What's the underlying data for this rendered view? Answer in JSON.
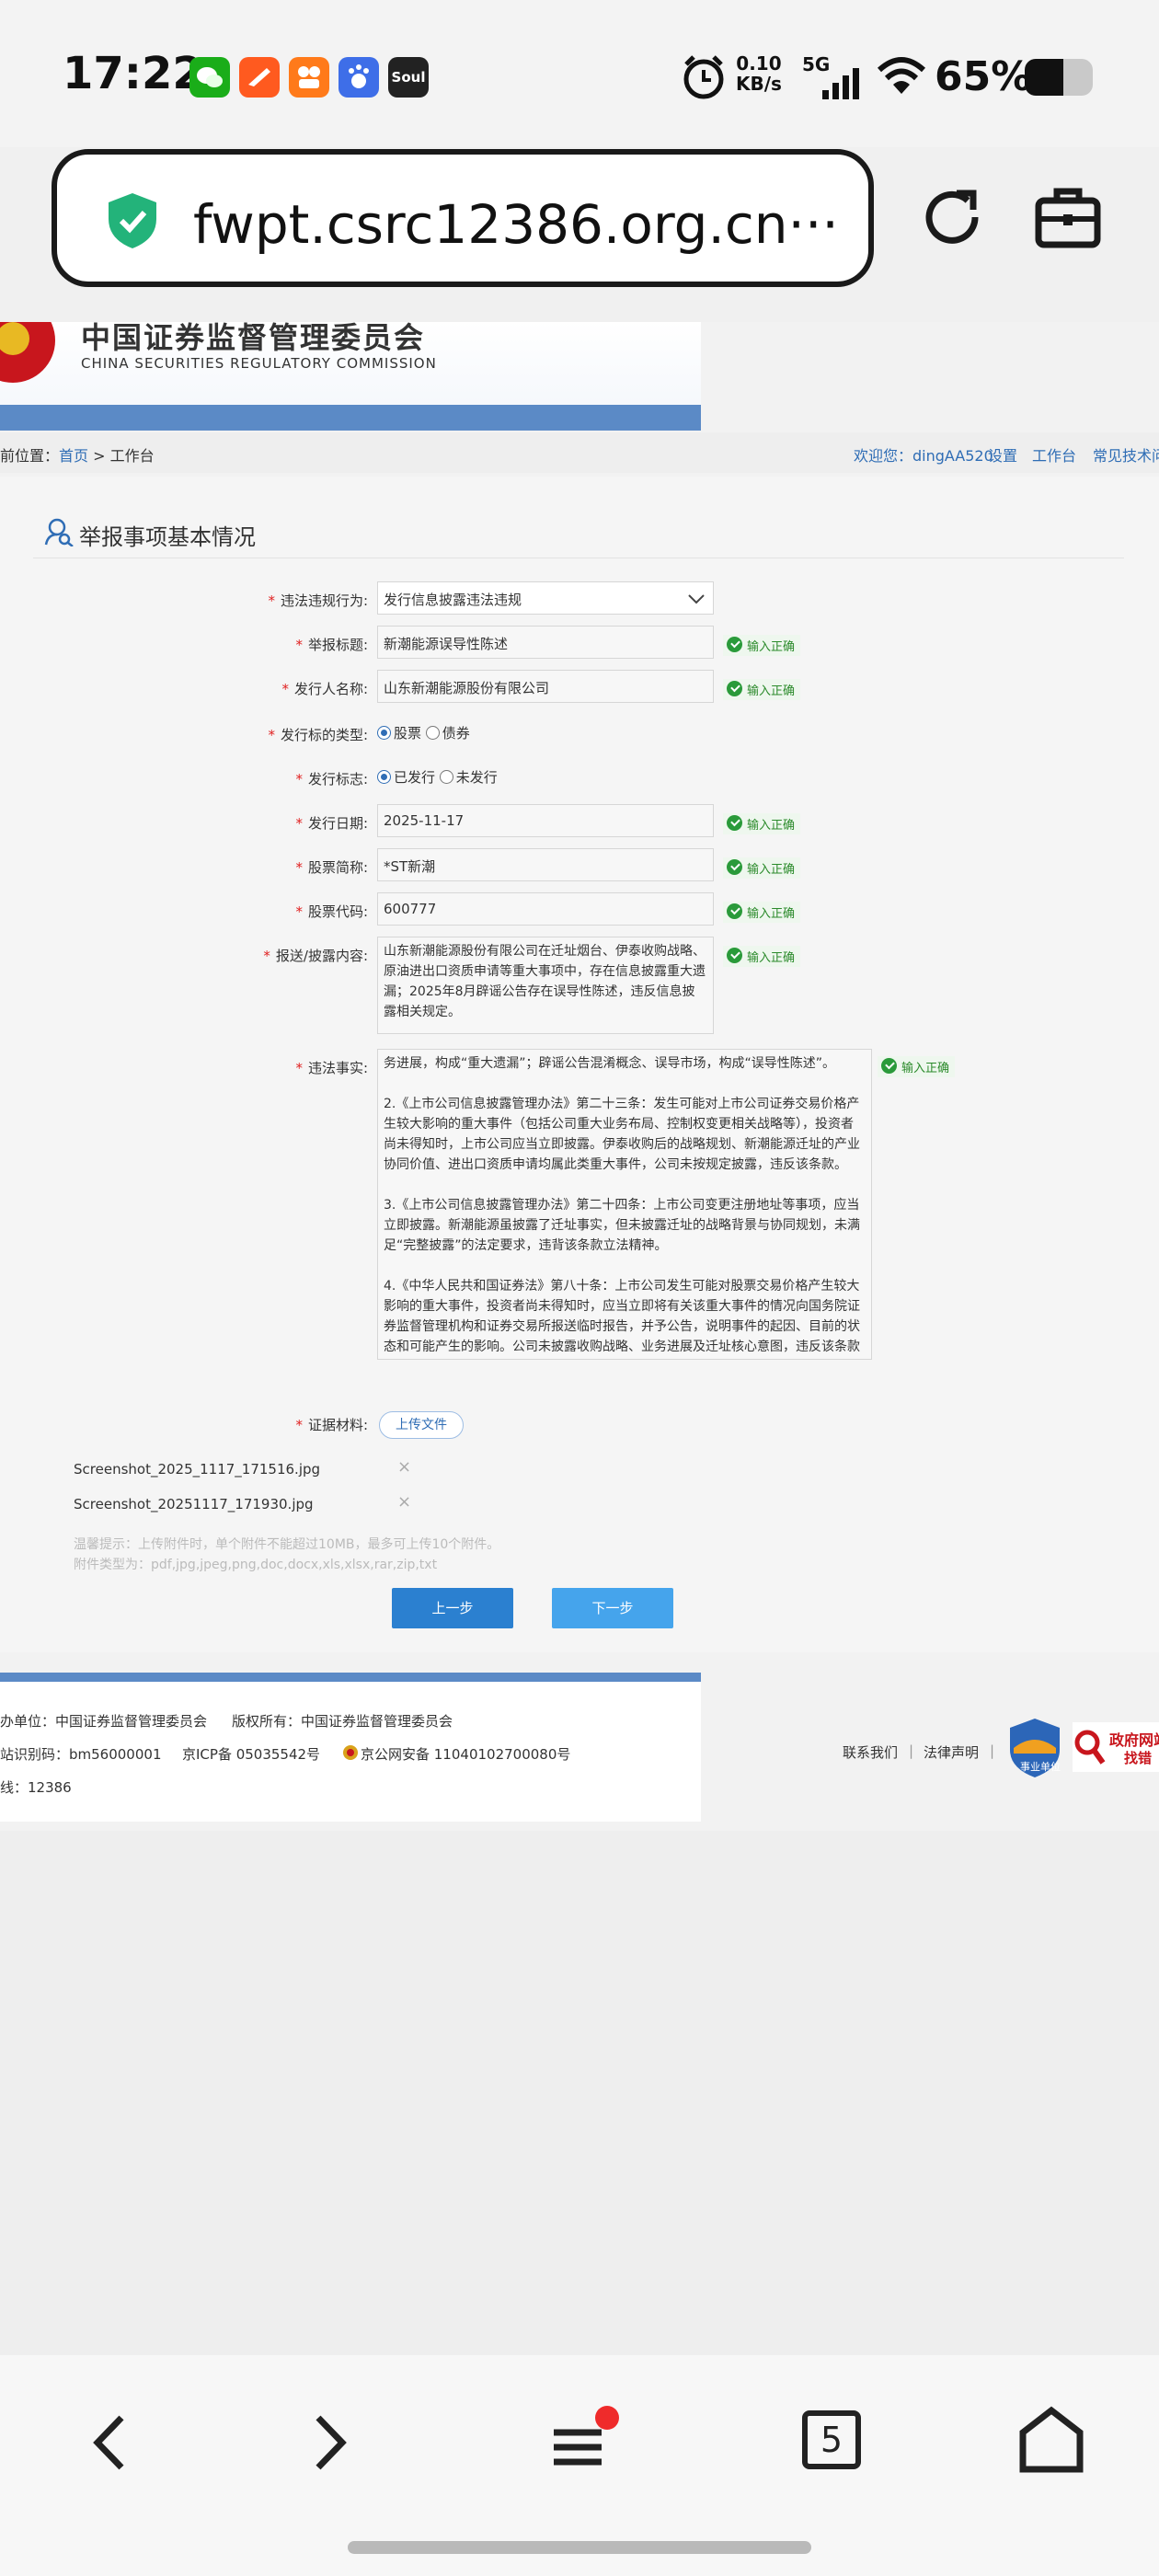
{
  "status_bar": {
    "time": "17:22",
    "net_speed_value": "0.10",
    "net_speed_unit": "KB/s",
    "network": "5G",
    "battery": "65%",
    "apps": [
      {
        "name": "wechat-icon",
        "color": "#1aad19"
      },
      {
        "name": "feishu-icon",
        "color": "#ff5a1f"
      },
      {
        "name": "kuaishou-icon",
        "color": "#ff7a1a"
      },
      {
        "name": "baidu-icon",
        "color": "#3e6ee8"
      },
      {
        "name": "soul-icon",
        "color": "#222222",
        "label": "Soul"
      }
    ]
  },
  "browser": {
    "url": "fwpt.csrc12386.org.cn···"
  },
  "site": {
    "banner_cn": "中国证券监督管理委员会",
    "banner_en": "CHINA SECURITIES REGULATORY COMMISSION",
    "breadcrumb_prefix": "前位置：",
    "breadcrumb_home": "首页",
    "breadcrumb_sep": " > ",
    "breadcrumb_current": "工作台",
    "welcome": "欢迎您：dingAA520",
    "links": [
      "设置",
      "工作台",
      "常见技术问"
    ]
  },
  "form": {
    "section_title": "举报事项基本情况",
    "ok_text": "输入正确",
    "fields": {
      "behavior": {
        "label": "违法违规行为:",
        "value": "发行信息披露违法违规"
      },
      "title": {
        "label": "举报标题:",
        "value": "新潮能源误导性陈述"
      },
      "issuer": {
        "label": "发行人名称:",
        "value": "山东新潮能源股份有限公司"
      },
      "type": {
        "label": "发行标的类型:",
        "options": [
          "股票",
          "债券"
        ],
        "selected": "股票"
      },
      "flag": {
        "label": "发行标志:",
        "options": [
          "已发行",
          "未发行"
        ],
        "selected": "已发行"
      },
      "date": {
        "label": "发行日期:",
        "value": "2025-11-17"
      },
      "stock_name": {
        "label": "股票简称:",
        "value": "*ST新潮"
      },
      "stock_code": {
        "label": "股票代码:",
        "value": "600777"
      },
      "disclosure": {
        "label": "报送/披露内容:",
        "value": "山东新潮能源股份有限公司在迁址烟台、伊泰收购战略、原油进出口资质申请等重大事项中，存在信息披露重大遗漏；2025年8月辟谣公告存在误导性陈述，违反信息披露相关规定。"
      },
      "facts": {
        "label": "违法事实:",
        "value": "务进展，构成“重大遗漏”；辟谣公告混淆概念、误导市场，构成“误导性陈述”。\n\n2.《上市公司信息披露管理办法》第二十三条：发生可能对上市公司证券交易价格产生较大影响的重大事件（包括公司重大业务布局、控制权变更相关战略等），投资者尚未得知时，上市公司应当立即披露。伊泰收购后的战略规划、新潮能源迁址的产业协同价值、进出口资质申请均属此类重大事件，公司未按规定披露，违反该条款。\n\n3.《上市公司信息披露管理办法》第二十四条：上市公司变更注册地址等事项，应当立即披露。新潮能源虽披露了迁址事实，但未披露迁址的战略背景与协同规划，未满足“完整披露”的法定要求，违背该条款立法精神。\n\n4.《中华人民共和国证券法》第八十条：上市公司发生可能对股票交易价格产生较大影响的重大事件，投资者尚未得知时，应当立即将有关该重大事件的情况向国务院证券监督管理机构和证券交易所报送临时报告，并予公告，说明事件的起因、目前的状态和可能产生的影响。公司未披露收购战略、业务进展及迁址核心意图，违反该条款关于重大事件披露的强制性规定。"
      },
      "evidence": {
        "label": "证据材料:",
        "upload": "上传文件"
      }
    },
    "files": [
      "Screenshot_2025_1117_171516.jpg",
      "Screenshot_20251117_171930.jpg"
    ],
    "hint_line1": "温馨提示：上传附件时，单个附件不能超过10MB，最多可上传10个附件。",
    "hint_line2": "附件类型为：pdf,jpg,jpeg,png,doc,docx,xls,xlsx,rar,zip,txt",
    "prev": "上一步",
    "next": "下一步"
  },
  "footer": {
    "host": "办单位：中国证券监督管理委员会",
    "copyright": "版权所有：中国证券监督管理委员会",
    "site_id": "站识别码：bm56000001",
    "icp": "京ICP备 05035542号",
    "police": "京公网安备 11040102700080号",
    "hotline": "线：12386",
    "contact": "联系我们",
    "legal": "法律声明",
    "badge_text": "事业单位",
    "gov_text_1": "政府网站",
    "gov_text_2": "找错"
  },
  "bottom_nav": {
    "tabs_count": "5"
  }
}
